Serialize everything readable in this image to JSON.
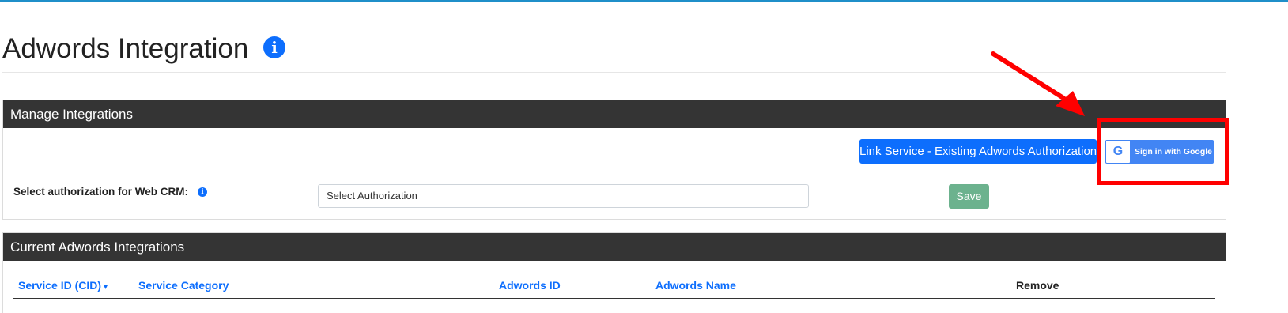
{
  "page": {
    "title": "Adwords Integration",
    "info_icon": "info-icon"
  },
  "manage_panel": {
    "header": "Manage Integrations",
    "link_button_label": "Link Service - Existing Adwords Authorization",
    "google_button_label": "Sign in with Google",
    "google_logo_letter": "G",
    "field_label": "Select authorization for Web CRM:",
    "select_value": "Select Authorization",
    "save_label": "Save"
  },
  "current_panel": {
    "header": "Current Adwords Integrations",
    "columns": [
      "Service ID (CID)",
      "Service Category",
      "Adwords ID",
      "Adwords Name",
      "Remove"
    ],
    "sort_indicator": "▾"
  },
  "annotation": {
    "highlight_color": "#ff0000"
  },
  "colors": {
    "primary": "#0d6efd",
    "header_bg": "#343434",
    "save_button": "#6cb28e",
    "google_blue": "#4285f4",
    "top_bar": "#1f8fc9"
  }
}
